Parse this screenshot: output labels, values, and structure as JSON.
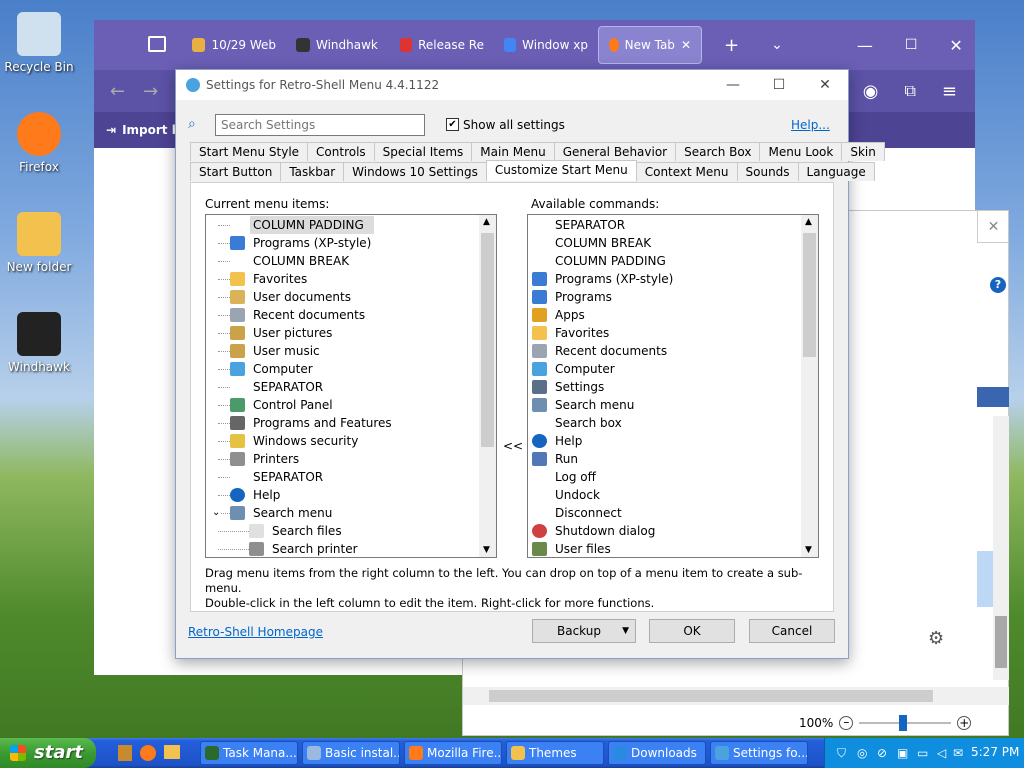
{
  "desktop": {
    "icons": [
      {
        "label": "Recycle Bin",
        "icon": "recycle-bin-icon"
      },
      {
        "label": "Firefox",
        "icon": "firefox-icon"
      },
      {
        "label": "New folder",
        "icon": "folder-icon"
      },
      {
        "label": "Windhawk",
        "icon": "windhawk-icon"
      }
    ]
  },
  "browser": {
    "tabs": [
      {
        "label": "10/29 Web"
      },
      {
        "label": "Windhawk"
      },
      {
        "label": "Release Re"
      },
      {
        "label": "Window xp"
      },
      {
        "label": "New Tab"
      }
    ],
    "bookmark": "Import bo",
    "zoom": "100%"
  },
  "dialog": {
    "title": "Settings for Retro-Shell Menu 4.4.1122",
    "search_placeholder": "Search Settings",
    "show_all_label": "Show all settings",
    "help_link": "Help...",
    "tabs_row1": [
      "Start Menu Style",
      "Controls",
      "Special Items",
      "Main Menu",
      "General Behavior",
      "Search Box",
      "Menu Look",
      "Skin"
    ],
    "tabs_row2": [
      "Start Button",
      "Taskbar",
      "Windows 10 Settings",
      "Customize Start Menu",
      "Context Menu",
      "Sounds",
      "Language"
    ],
    "selected_tab": "Customize Start Menu",
    "current_label": "Current menu items:",
    "available_label": "Available commands:",
    "move_button": "<<",
    "current_items": [
      {
        "label": "COLUMN PADDING",
        "icon": "none",
        "indent": 0,
        "selected": true
      },
      {
        "label": "Programs (XP-style)",
        "icon": "programs-icon",
        "indent": 0
      },
      {
        "label": "COLUMN BREAK",
        "icon": "none",
        "indent": 0
      },
      {
        "label": "Favorites",
        "icon": "star-icon",
        "indent": 0
      },
      {
        "label": "User documents",
        "icon": "documents-icon",
        "indent": 0
      },
      {
        "label": "Recent documents",
        "icon": "recent-icon",
        "indent": 0
      },
      {
        "label": "User pictures",
        "icon": "pictures-icon",
        "indent": 0
      },
      {
        "label": "User music",
        "icon": "music-icon",
        "indent": 0
      },
      {
        "label": "Computer",
        "icon": "computer-icon",
        "indent": 0
      },
      {
        "label": "SEPARATOR",
        "icon": "none",
        "indent": 0
      },
      {
        "label": "Control Panel",
        "icon": "control-panel-icon",
        "indent": 0
      },
      {
        "label": "Programs and Features",
        "icon": "features-icon",
        "indent": 0
      },
      {
        "label": "Windows security",
        "icon": "lock-icon",
        "indent": 0
      },
      {
        "label": "Printers",
        "icon": "printer-icon",
        "indent": 0
      },
      {
        "label": "SEPARATOR",
        "icon": "none",
        "indent": 0
      },
      {
        "label": "Help",
        "icon": "help-icon",
        "indent": 0
      },
      {
        "label": "Search menu",
        "icon": "search-icon",
        "indent": 0,
        "expanded": true
      },
      {
        "label": "Search files",
        "icon": "file-icon",
        "indent": 1
      },
      {
        "label": "Search printer",
        "icon": "printer-icon",
        "indent": 1
      }
    ],
    "available_items": [
      {
        "label": "SEPARATOR",
        "icon": "none"
      },
      {
        "label": "COLUMN BREAK",
        "icon": "none"
      },
      {
        "label": "COLUMN PADDING",
        "icon": "none"
      },
      {
        "label": "Programs (XP-style)",
        "icon": "programs-icon"
      },
      {
        "label": "Programs",
        "icon": "programs-icon"
      },
      {
        "label": "Apps",
        "icon": "apps-icon"
      },
      {
        "label": "Favorites",
        "icon": "star-icon"
      },
      {
        "label": "Recent documents",
        "icon": "recent-icon"
      },
      {
        "label": "Computer",
        "icon": "computer-icon"
      },
      {
        "label": "Settings",
        "icon": "settings-icon"
      },
      {
        "label": "Search menu",
        "icon": "search-icon"
      },
      {
        "label": "Search box",
        "icon": "none"
      },
      {
        "label": "Help",
        "icon": "help-icon"
      },
      {
        "label": "Run",
        "icon": "run-icon"
      },
      {
        "label": "Log off",
        "icon": "none"
      },
      {
        "label": "Undock",
        "icon": "none"
      },
      {
        "label": "Disconnect",
        "icon": "none"
      },
      {
        "label": "Shutdown dialog",
        "icon": "shutdown-icon"
      },
      {
        "label": "User files",
        "icon": "user-icon"
      }
    ],
    "instructions": "Drag menu items from the right column to the left. You can drop on top of a menu item to create a sub-menu.\nDouble-click in the left column to edit the item. Right-click for more functions.",
    "homepage_link": "Retro-Shell Homepage",
    "backup_button": "Backup",
    "ok_button": "OK",
    "cancel_button": "Cancel"
  },
  "taskbar": {
    "start_label": "start",
    "buttons": [
      "Task Mana...",
      "Basic instal...",
      "Mozilla Fire...",
      "Themes",
      "Downloads",
      "Settings fo..."
    ],
    "clock": "5:27 PM"
  },
  "colors": {
    "accent": "#0066cc",
    "browser_header": "#6a5fb5",
    "taskbar": "#245edb",
    "start_green": "#3b9a32"
  }
}
